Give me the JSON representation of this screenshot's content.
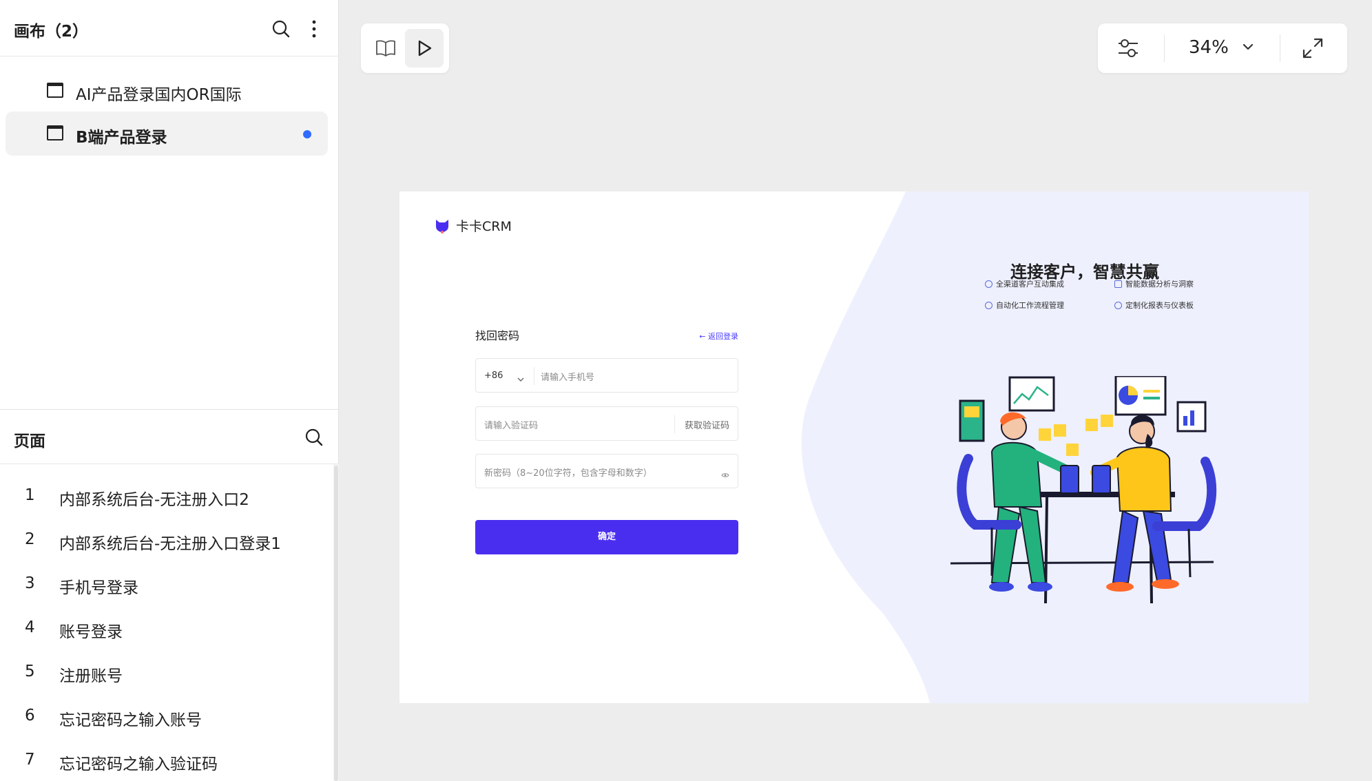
{
  "sidebar": {
    "canvas_title": "画布（2）",
    "canvases": [
      {
        "label": "AI产品登录国内OR国际",
        "active": false
      },
      {
        "label": "B端产品登录",
        "active": true
      }
    ],
    "pages_title": "页面",
    "pages": [
      {
        "num": "1",
        "label": "内部系统后台-无注册入口2"
      },
      {
        "num": "2",
        "label": "内部系统后台-无注册入口登录1"
      },
      {
        "num": "3",
        "label": "手机号登录"
      },
      {
        "num": "4",
        "label": "账号登录"
      },
      {
        "num": "5",
        "label": "注册账号"
      },
      {
        "num": "6",
        "label": "忘记密码之输入账号"
      },
      {
        "num": "7",
        "label": "忘记密码之输入验证码"
      }
    ]
  },
  "toolbar": {
    "zoom": "34%"
  },
  "artboard": {
    "brand": "卡卡CRM",
    "form_title": "找回密码",
    "back_link": "← 返回登录",
    "country_code": "+86",
    "phone_placeholder": "请输入手机号",
    "code_placeholder": "请输入验证码",
    "get_code": "获取验证码",
    "password_placeholder": "新密码（8~20位字符，包含字母和数字）",
    "confirm_label": "确定",
    "hero_title": "连接客户，智慧共赢",
    "features": [
      "全渠道客户互动集成",
      "智能数据分析与洞察",
      "自动化工作流程管理",
      "定制化报表与仪表板"
    ]
  },
  "colors": {
    "accent": "#4a2ef0",
    "active_dot": "#2f6bff",
    "hero_bg": "#eef0fd"
  }
}
